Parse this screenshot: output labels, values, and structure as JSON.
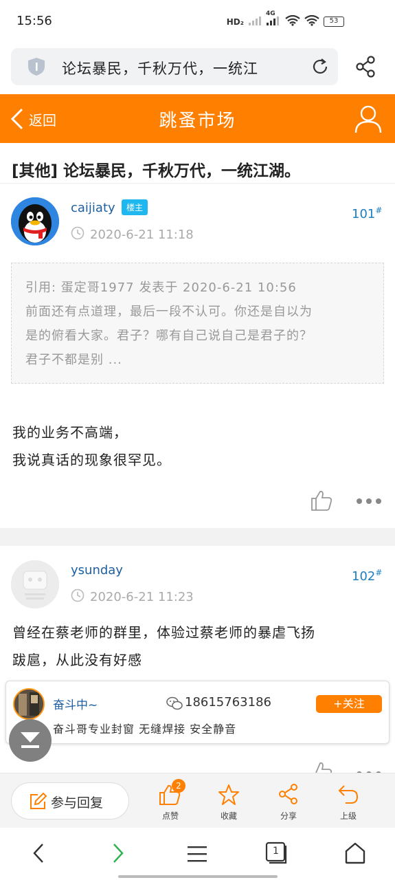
{
  "status_bar": {
    "time": "15:56",
    "network_label": "HD₂",
    "signal_label": "4G",
    "battery": "53"
  },
  "browser": {
    "url_text": "论坛暴民，千秋万代，一统江"
  },
  "header": {
    "back_label": "返回",
    "title": "跳蚤市场"
  },
  "thread": {
    "title": "[其他] 论坛暴民，千秋万代，一统江湖。"
  },
  "posts": [
    {
      "username": "caijiaty",
      "badge": "楼主",
      "floor": "101",
      "floor_mark": "#",
      "time": "2020-6-21 11:18",
      "quote_lines": [
        "引用: 蛋定哥1977 发表于 2020-6-21 10:56",
        "前面还有点道理，最后一段不认可。你还是自以为",
        "是的俯看大家。君子？哪有自己说自己是君子的？",
        "君子不都是别 ..."
      ],
      "content_lines": [
        "我的业务不高端，",
        "我说真话的现象很罕见。"
      ]
    },
    {
      "username": "ysunday",
      "floor": "102",
      "floor_mark": "#",
      "time": "2020-6-21 11:23",
      "content_lines": [
        "曾经在蔡老师的群里，体验过蔡老师的暴虐飞扬",
        "跋扈，从此没有好感"
      ]
    }
  ],
  "ad": {
    "name": "奋斗中~",
    "phone": "18615763186",
    "follow_label": "+关注",
    "description": "奋斗哥专业封窗 无缝焊接 安全静音"
  },
  "action_bar": {
    "reply_label": "参与回复",
    "like_label": "点赞",
    "like_count": "2",
    "favorite_label": "收藏",
    "share_label": "分享",
    "up_label": "上级"
  },
  "nav": {
    "tab_count": "1"
  },
  "colors": {
    "accent": "#ff7f00",
    "link": "#1d5fa0",
    "badge": "#1fb7f0"
  }
}
